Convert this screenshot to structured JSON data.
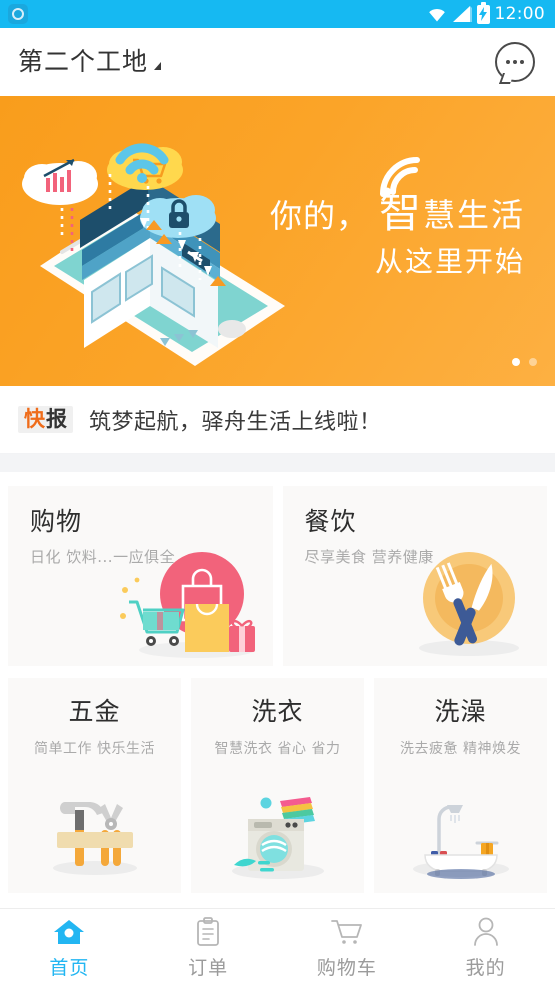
{
  "status_bar": {
    "app_icon": "app-logo-icon",
    "wifi_icon": "wifi-icon",
    "signal_icon": "signal-bars-icon",
    "battery_icon": "battery-charging-icon",
    "time": "12:00",
    "bg_color": "#16b9f2"
  },
  "header": {
    "title": "第二个工地",
    "dropdown_icon": "caret-down-icon",
    "chat_icon": "chat-bubble-icon"
  },
  "banner": {
    "line1_prefix": "你的，",
    "line1_big": "智",
    "line1_rest": "慧生活",
    "line2": "从这里开始",
    "wifi_icon": "wifi-signal-icon",
    "illustration": "smart-home-phone-illustration",
    "bg_color": "#f99d1c",
    "dots": [
      {
        "active": true
      },
      {
        "active": false
      }
    ]
  },
  "news": {
    "badge_part1": "快",
    "badge_part2": "报",
    "text": "筑梦起航，驿舟生活上线啦！"
  },
  "categories": {
    "top_row": [
      {
        "title": "购物",
        "subtitle": "日化 饮料...一应俱全",
        "icon": "shopping-bag-illustration",
        "accent": "#f2637b"
      },
      {
        "title": "餐饮",
        "subtitle": "尽享美食 营养健康",
        "icon": "fork-knife-plate-illustration",
        "accent": "#f0ad4e"
      }
    ],
    "bottom_row": [
      {
        "title": "五金",
        "subtitle": "简单工作 快乐生活",
        "icon": "hammer-pliers-illustration",
        "accent": "#f4a83a"
      },
      {
        "title": "洗衣",
        "subtitle": "智慧洗衣 省心 省力",
        "icon": "washing-machine-illustration",
        "accent": "#5fd4cf"
      },
      {
        "title": "洗澡",
        "subtitle": "洗去疲惫 精神焕发",
        "icon": "bathtub-shower-illustration",
        "accent": "#f5a623"
      }
    ]
  },
  "bottom_nav": {
    "active_color": "#22b6f2",
    "inactive_color": "#9b9b9b",
    "items": [
      {
        "label": "首页",
        "icon": "home-icon",
        "active": true
      },
      {
        "label": "订单",
        "icon": "clipboard-icon",
        "active": false
      },
      {
        "label": "购物车",
        "icon": "cart-icon",
        "active": false
      },
      {
        "label": "我的",
        "icon": "person-icon",
        "active": false
      }
    ]
  }
}
